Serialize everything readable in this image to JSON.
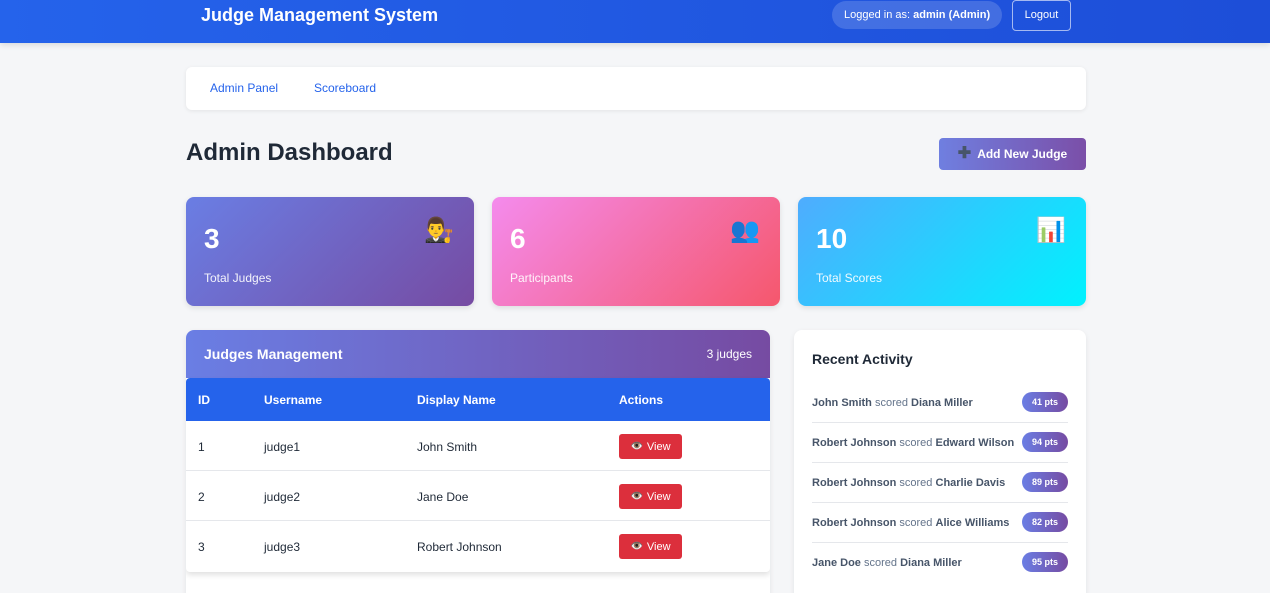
{
  "header": {
    "brand": "Judge Management System",
    "logged_in_prefix": "Logged in as:",
    "logged_in_user": "admin (Admin)",
    "logout_label": "Logout"
  },
  "nav": {
    "items": [
      {
        "label": "Admin Panel"
      },
      {
        "label": "Scoreboard"
      }
    ]
  },
  "page": {
    "title": "Admin Dashboard",
    "add_button_icon": "plus-icon",
    "add_button_label": "Add New Judge"
  },
  "stats": [
    {
      "value": "3",
      "label": "Total Judges",
      "icon": "judge-icon",
      "glyph": "👨‍⚖️"
    },
    {
      "value": "6",
      "label": "Participants",
      "icon": "people-icon",
      "glyph": "👥"
    },
    {
      "value": "10",
      "label": "Total Scores",
      "icon": "bar-chart-icon",
      "glyph": "📊"
    }
  ],
  "judges": {
    "title": "Judges Management",
    "count": "3 judges",
    "columns": [
      "ID",
      "Username",
      "Display Name",
      "Actions"
    ],
    "view_label": "View",
    "rows": [
      {
        "id": "1",
        "username": "judge1",
        "display_name": "John Smith"
      },
      {
        "id": "2",
        "username": "judge2",
        "display_name": "Jane Doe"
      },
      {
        "id": "3",
        "username": "judge3",
        "display_name": "Robert Johnson"
      }
    ]
  },
  "activity": {
    "title": "Recent Activity",
    "verb": "scored",
    "items": [
      {
        "judge": "John Smith",
        "participant": "Diana Miller",
        "points": "41 pts"
      },
      {
        "judge": "Robert Johnson",
        "participant": "Edward Wilson",
        "points": "94 pts"
      },
      {
        "judge": "Robert Johnson",
        "participant": "Charlie Davis",
        "points": "89 pts"
      },
      {
        "judge": "Robert Johnson",
        "participant": "Alice Williams",
        "points": "82 pts"
      },
      {
        "judge": "Jane Doe",
        "participant": "Diana Miller",
        "points": "95 pts"
      }
    ]
  },
  "colors": {
    "primary": "#2563eb",
    "accent_start": "#6a7ee4",
    "accent_end": "#764ba2",
    "danger": "#dc2f3c"
  }
}
